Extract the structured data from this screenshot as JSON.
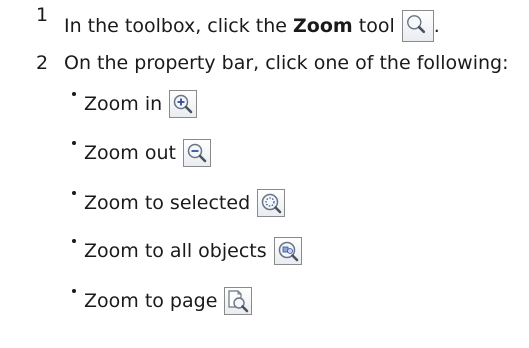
{
  "steps": [
    {
      "number": "1",
      "text_before": "In the toolbox, click the",
      "bold": "Zoom",
      "text_after": "tool",
      "end_punct": ".",
      "icon": "zoom-tool-icon"
    },
    {
      "number": "2",
      "text": "On the property bar, click one of the following:"
    }
  ],
  "options": [
    {
      "label": "Zoom in",
      "icon": "zoom-in-icon"
    },
    {
      "label": "Zoom out",
      "icon": "zoom-out-icon"
    },
    {
      "label": "Zoom to selected",
      "icon": "zoom-to-selected-icon"
    },
    {
      "label": "Zoom to all objects",
      "icon": "zoom-to-all-objects-icon"
    },
    {
      "label": "Zoom to page",
      "icon": "zoom-to-page-icon"
    }
  ]
}
